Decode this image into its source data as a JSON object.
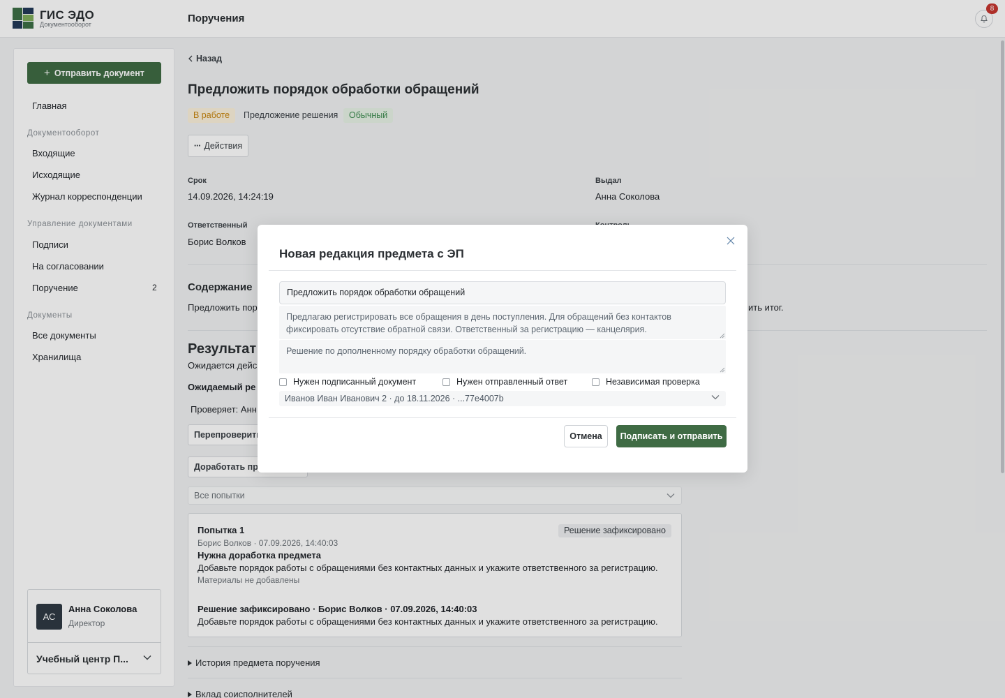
{
  "brand": {
    "title": "ГИС ЭДО",
    "subtitle": "Документооборот"
  },
  "header": {
    "page_title": "Поручения",
    "notifications_count": "8"
  },
  "sidebar": {
    "send_button": "Отправить документ",
    "home": "Главная",
    "sections": [
      {
        "title": "Документооборот",
        "items": [
          "Входящие",
          "Исходящие",
          "Журнал корреспонденции"
        ]
      },
      {
        "title": "Управление документами",
        "items": [
          "Подписи",
          "На согласовании",
          "Поручение"
        ]
      },
      {
        "title": "Документы",
        "items": [
          "Все документы",
          "Хранилища"
        ]
      }
    ],
    "assignment_count": "2",
    "user": {
      "initials": "АС",
      "name": "Анна Соколова",
      "role": "Директор"
    },
    "org": "Учебный центр П..."
  },
  "task": {
    "back": "Назад",
    "title": "Предложить порядок обработки обращений",
    "badges": {
      "status": "В работе",
      "stage": "Предложение решения",
      "priority": "Обычный"
    },
    "actions": "Действия",
    "deadline_label": "Срок",
    "deadline_value": "14.09.2026, 14:24:19",
    "issuer_label": "Выдал",
    "issuer_value": "Анна Соколова",
    "responsible_label": "Ответственный",
    "responsible_value": "Борис Волков",
    "control_label": "Контроль",
    "content_title": "Содержание",
    "content_text_left": "Предложить пор",
    "content_text_right": "ить итог.",
    "result_title": "Результат",
    "result_sub": "Ожидается дейс",
    "expected_label": "Ожидаемый ре",
    "checker": "Проверяет: Анн",
    "recheck_button": "Перепроверить",
    "rework_button": "Доработать пре",
    "attempts_select": "Все попытки",
    "attempt": {
      "title": "Попытка 1",
      "status": "Решение зафиксировано",
      "meta": "Борис Волков · 07.09.2026, 14:40:03",
      "heading": "Нужна доработка предмета",
      "text": "Добавьте порядок работы с обращениями без контактных данных и укажите ответственного за регистрацию.",
      "materials": "Материалы не добавлены",
      "decision": "Решение зафиксировано · Борис Волков · 07.09.2026, 14:40:03",
      "decision_text": "Добавьте порядок работы с обращениями без контактных данных и укажите ответственного за регистрацию."
    },
    "history": "История предмета поручения",
    "coexecutors": "Вклад соисполнителей"
  },
  "modal": {
    "title": "Новая редакция предмета с ЭП",
    "subject_value": "Предложить порядок обработки обращений",
    "description_value": "Предлагаю регистрировать все обращения в день поступления. Для обращений без контактов фиксировать отсутствие обратной связи. Ответственный за регистрацию — канцелярия.",
    "comment_value": "Решение по дополненному порядку обработки обращений.",
    "checkboxes": [
      "Нужен подписанный документ",
      "Нужен отправленный ответ",
      "Независимая проверка"
    ],
    "signer": "Иванов Иван Иванович 2 · до 18.11.2026 · ...77e4007b",
    "cancel": "Отмена",
    "sign_send": "Подписать и отправить"
  },
  "colors": {
    "accent": "#3f6b44",
    "status_badge": "#c8860f",
    "priority_badge": "#3b8a4e",
    "notification_badge": "#c7362f"
  }
}
